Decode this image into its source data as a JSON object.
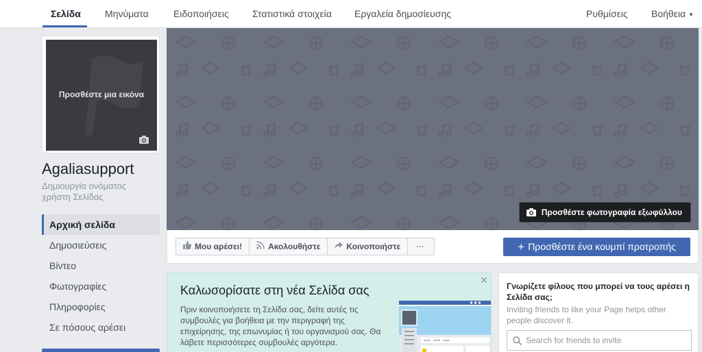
{
  "topnav": {
    "tabs_left": [
      {
        "label": "Σελίδα",
        "active": true
      },
      {
        "label": "Μηνύματα",
        "active": false
      },
      {
        "label": "Ειδοποιήσεις",
        "active": false
      },
      {
        "label": "Στατιστικά στοιχεία",
        "active": false
      },
      {
        "label": "Εργαλεία δημοσίευσης",
        "active": false
      }
    ],
    "settings_label": "Ρυθμίσεις",
    "help_label": "Βοήθεια",
    "help_caret": "▼"
  },
  "profile": {
    "add_picture_text": "Προσθέστε μια εικόνα",
    "page_name": "Agaliasupport",
    "create_username_text": "Δημιουργία ονόματος χρήστη Σελίδας"
  },
  "leftnav": {
    "items": [
      {
        "label": "Αρχική σελίδα",
        "active": true
      },
      {
        "label": "Δημοσιεύσεις",
        "active": false
      },
      {
        "label": "Βίντεο",
        "active": false
      },
      {
        "label": "Φωτογραφίες",
        "active": false
      },
      {
        "label": "Πληροφορίες",
        "active": false
      },
      {
        "label": "Σε πόσους αρέσει",
        "active": false
      }
    ]
  },
  "cover": {
    "add_cover_label": "Προσθέστε φωτογραφία εξωφύλλου",
    "pattern_color": "#6c7180"
  },
  "actions": {
    "like_label": "Μου αρέσει!",
    "follow_label": "Ακολουθήστε",
    "share_label": "Κοινοποιήστε",
    "more_label": "···",
    "cta_label": "Προσθέστε ένα κουμπί προτροπής",
    "cta_plus": "+"
  },
  "welcome": {
    "title": "Καλωσορίσατε στη νέα Σελίδα σας",
    "body": "Πριν κοινοποιήσετε τη Σελίδα σας, δείτε αυτές τις συμβουλές για βοήθεια με την περιγραφή της επιχείρησης, της επωνυμίας ή του οργανισμού σας. Θα λάβετε περισσότερες συμβουλές αργότερα.",
    "close_label": "✕"
  },
  "invite": {
    "title": "Γνωρίζετε φίλους που μπορεί να τους αρέσει η Σελίδα σας;",
    "subtitle": "Inviting friends to like your Page helps other people discover it.",
    "search_placeholder": "Search for friends to invite"
  },
  "colors": {
    "brand_blue": "#4267b2",
    "cover_gray": "#6c7180",
    "welcome_bg": "#d4eee9",
    "page_bg": "#e9ebee"
  }
}
